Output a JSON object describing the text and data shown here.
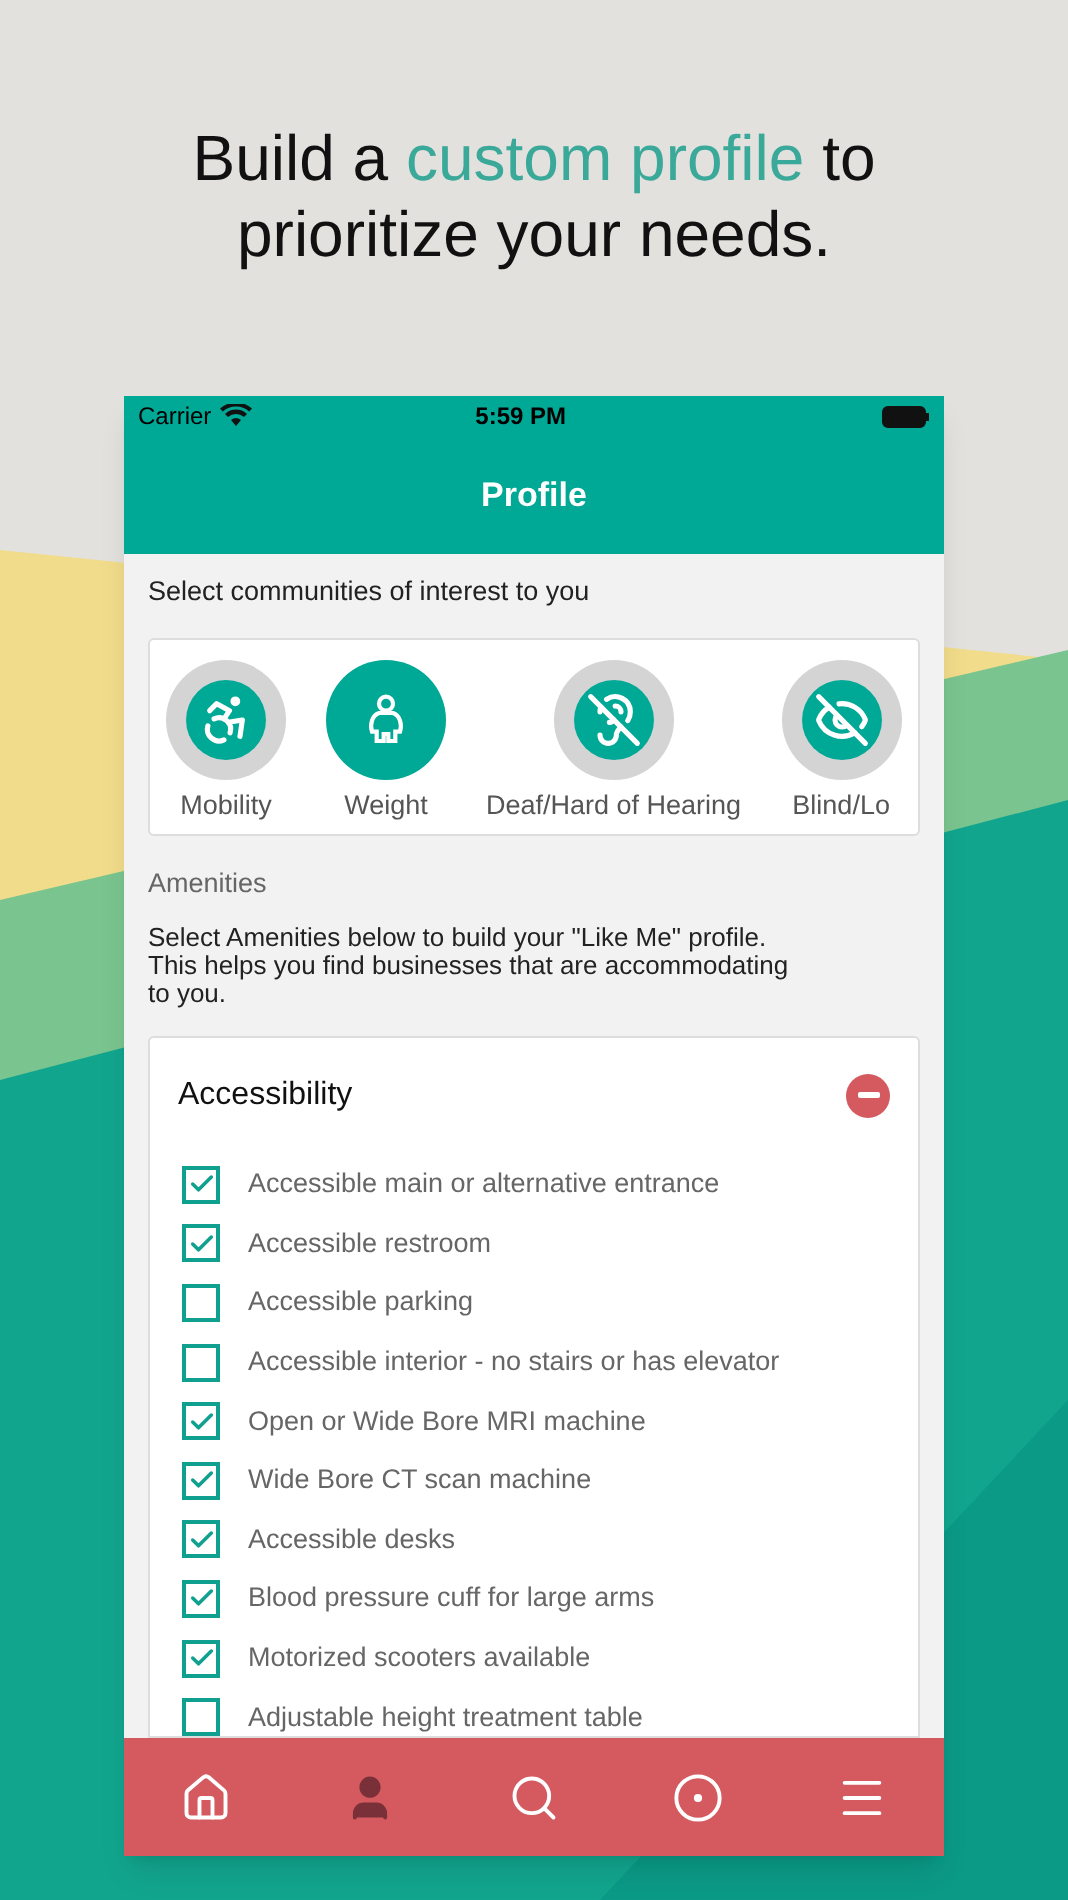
{
  "headline": {
    "before": "Build a ",
    "highlight": "custom profile",
    "after": " to prioritize your needs."
  },
  "status_bar": {
    "carrier": "Carrier",
    "time": "5:59 PM"
  },
  "nav_title": "Profile",
  "communities_prompt": "Select communities of interest to you",
  "communities": [
    {
      "kind": "mobility",
      "label": "Mobility",
      "selected": false
    },
    {
      "kind": "weight",
      "label": "Weight",
      "selected": true
    },
    {
      "kind": "hearing",
      "label": "Deaf/Hard of Hearing",
      "selected": false
    },
    {
      "kind": "vision",
      "label": "Blind/Lo",
      "selected": false
    }
  ],
  "amenities_heading": "Amenities",
  "amenities_intro": "Select Amenities below to build your \"Like Me\" profile. This helps you find businesses that are accommodating to you.",
  "section": {
    "title": "Accessibility",
    "expanded": true,
    "items": [
      {
        "label": "Accessible main or alternative entrance",
        "checked": true
      },
      {
        "label": "Accessible restroom",
        "checked": true
      },
      {
        "label": "Accessible parking",
        "checked": false
      },
      {
        "label": "Accessible interior - no stairs or has elevator",
        "checked": false
      },
      {
        "label": "Open or Wide Bore MRI machine",
        "checked": true
      },
      {
        "label": "Wide Bore CT scan machine",
        "checked": true
      },
      {
        "label": "Accessible desks",
        "checked": true
      },
      {
        "label": "Blood pressure cuff for large arms",
        "checked": true
      },
      {
        "label": "Motorized scooters available",
        "checked": true
      },
      {
        "label": "Adjustable height treatment table",
        "checked": false
      }
    ]
  },
  "tabs": [
    {
      "kind": "home",
      "selected": false
    },
    {
      "kind": "profile",
      "selected": true
    },
    {
      "kind": "search",
      "selected": false
    },
    {
      "kind": "nearby",
      "selected": false
    },
    {
      "kind": "menu",
      "selected": false
    }
  ]
}
